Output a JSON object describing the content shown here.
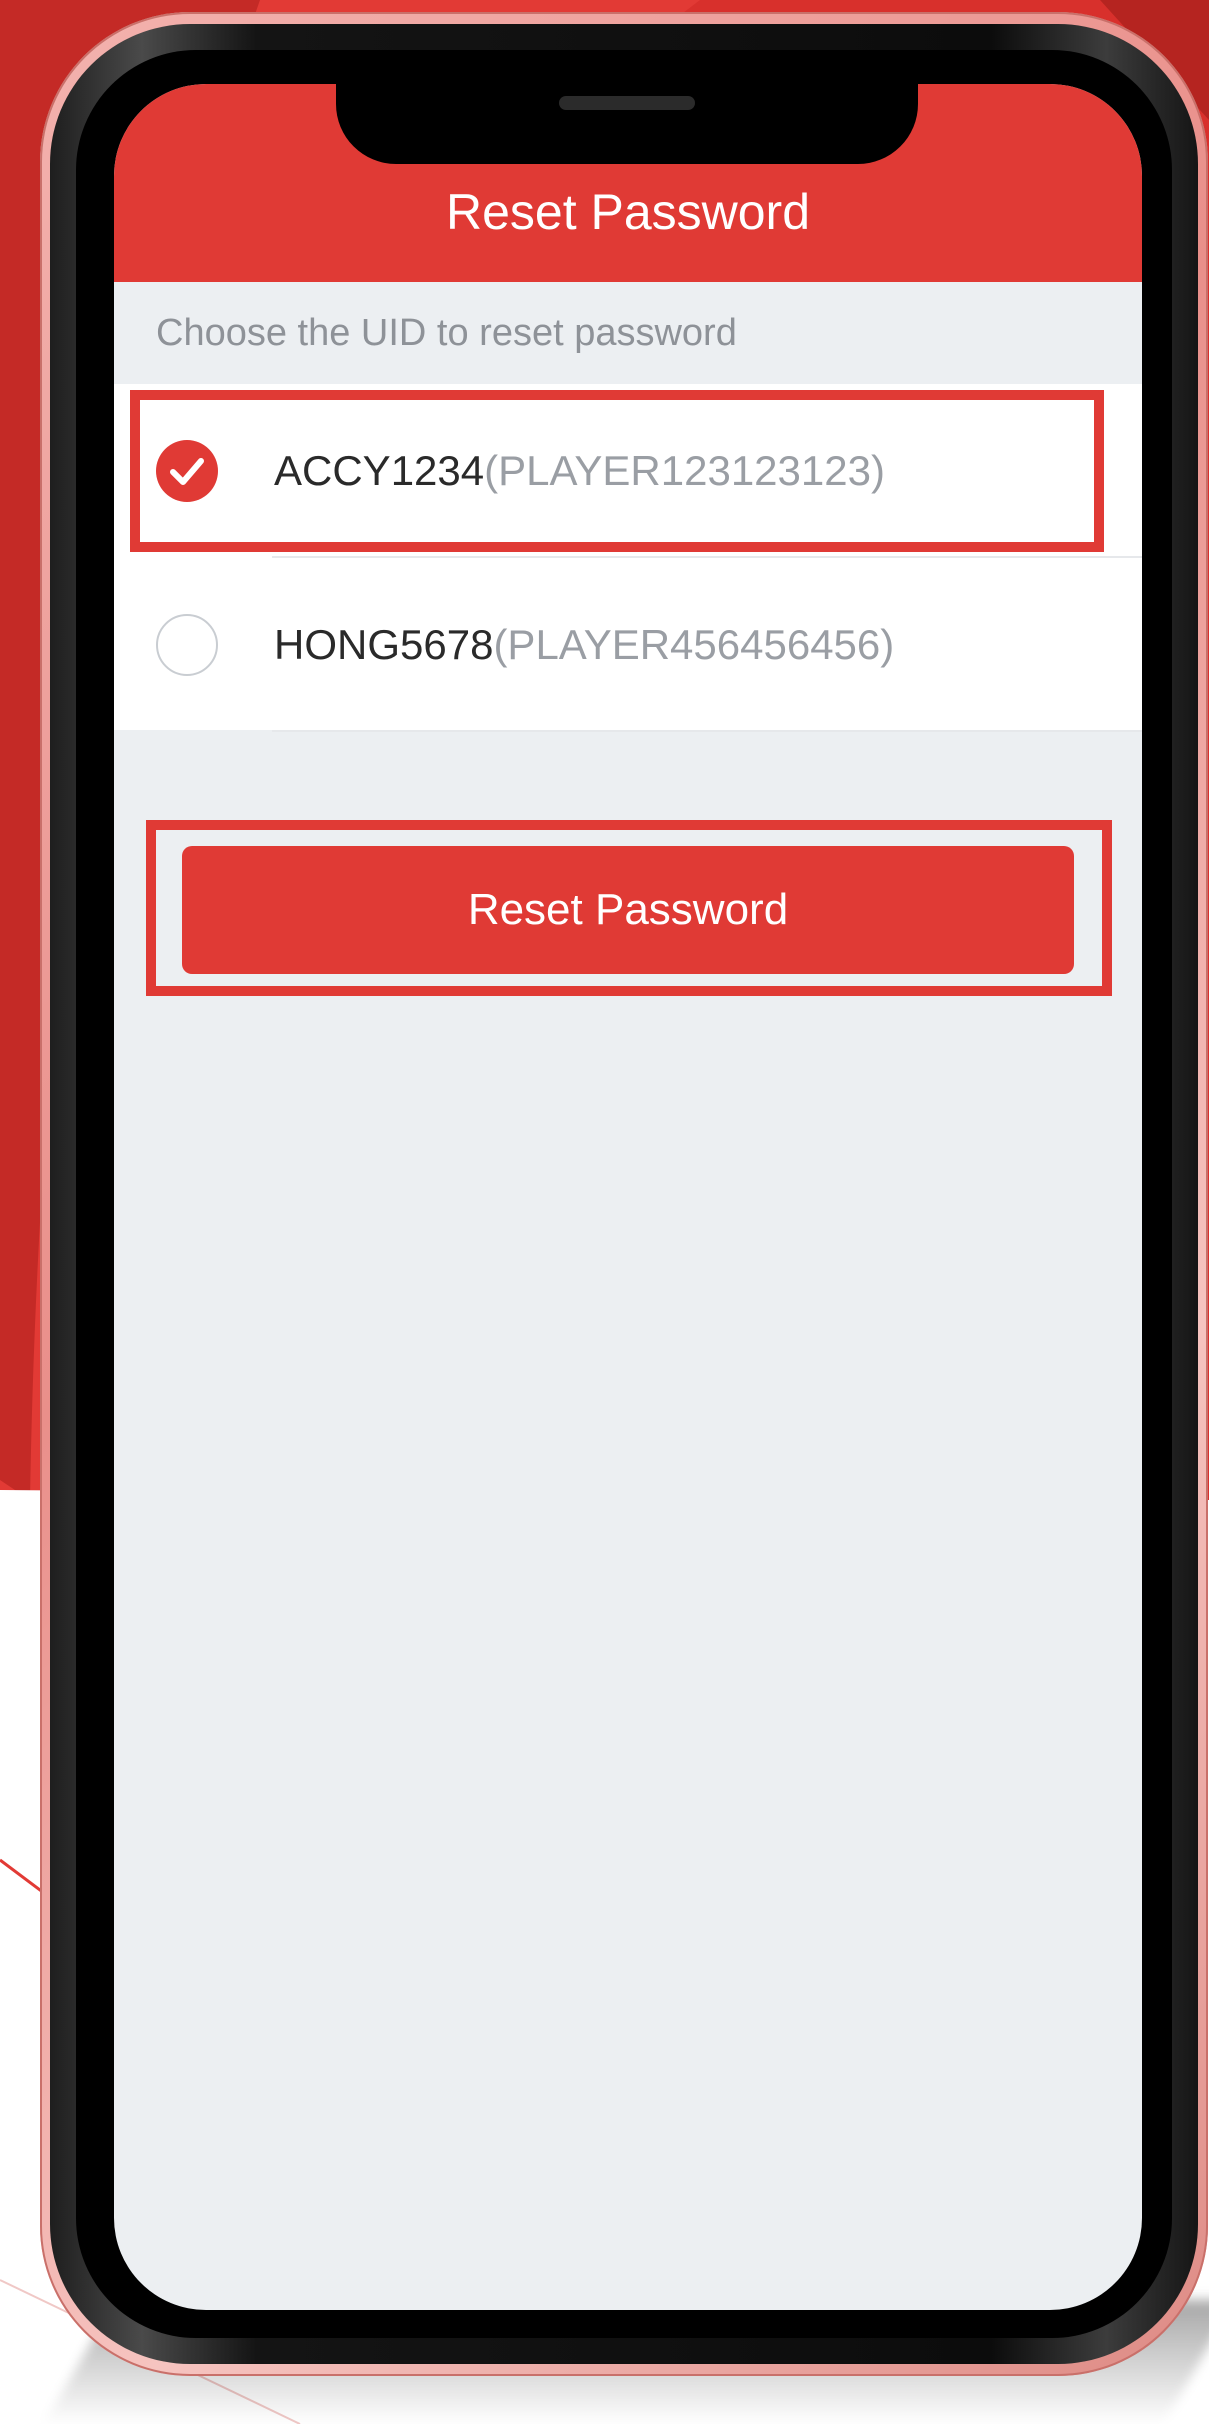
{
  "header": {
    "title": "Reset Password"
  },
  "instructions": "Choose the UID to reset password",
  "accounts": [
    {
      "uid": "ACCY1234",
      "player": "(PLAYER123123123)",
      "selected": true
    },
    {
      "uid": "HONG5678",
      "player": "(PLAYER456456456)",
      "selected": false
    }
  ],
  "actions": {
    "reset_label": "Reset Password"
  },
  "icons": {
    "selected": "check-circle-icon",
    "unselected": "empty-circle-icon"
  },
  "colors": {
    "accent": "#e03a35",
    "screen_bg": "#eceff2",
    "phone_frame": "#f0a8a4"
  }
}
